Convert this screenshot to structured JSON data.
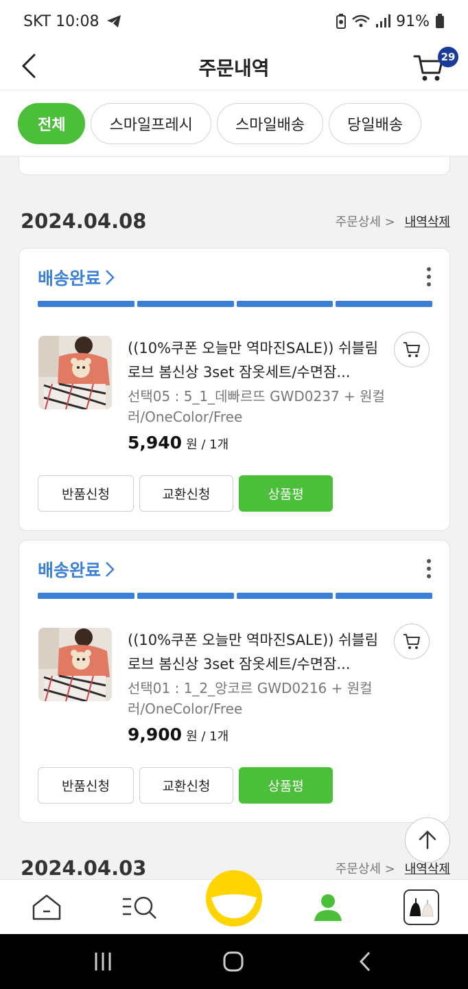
{
  "status_bar": {
    "carrier_time": "SKT 10:08",
    "battery": "91%"
  },
  "header": {
    "title": "주문내역",
    "cart_count": "29"
  },
  "tabs": [
    {
      "label": "전체",
      "active": true
    },
    {
      "label": "스마일프레시",
      "active": false
    },
    {
      "label": "스마일배송",
      "active": false
    },
    {
      "label": "당일배송",
      "active": false
    }
  ],
  "groups": [
    {
      "date": "2024.04.08",
      "detail_label": "주문상세 >",
      "delete_label": "내역삭제",
      "orders": [
        {
          "status": "배송완료",
          "title": "((10%쿠폰 오늘만 역마진SALE)) 쉬블림로브 봄신상 3set 잠옷세트/수면잠...",
          "option": "선택05 : 5_1_데빠르뜨 GWD0237 + 원컬러/OneColor/Free",
          "price": "5,940",
          "price_unit": "원 / 1개",
          "buttons": [
            "반품신청",
            "교환신청",
            "상품평"
          ]
        },
        {
          "status": "배송완료",
          "title": "((10%쿠폰 오늘만 역마진SALE)) 쉬블림로브 봄신상 3set 잠옷세트/수면잠...",
          "option": "선택01 : 1_2_앙코르 GWD0216 + 원컬러/OneColor/Free",
          "price": "9,900",
          "price_unit": "원 / 1개",
          "buttons": [
            "반품신청",
            "교환신청",
            "상품평"
          ]
        }
      ]
    },
    {
      "date": "2024.04.03",
      "detail_label": "주문상세 >",
      "delete_label": "내역삭제"
    }
  ],
  "colors": {
    "accent_green": "#4cbf3a",
    "status_blue": "#3b7fd6",
    "badge_navy": "#1a3a9a",
    "smile_yellow": "#ffd400"
  },
  "icons": [
    "back-icon",
    "cart-icon",
    "kebab-icon",
    "add-to-cart-icon",
    "scroll-top-icon",
    "home-icon",
    "category-search-icon",
    "smile-icon",
    "my-page-icon",
    "wishlist-bag-icon"
  ]
}
